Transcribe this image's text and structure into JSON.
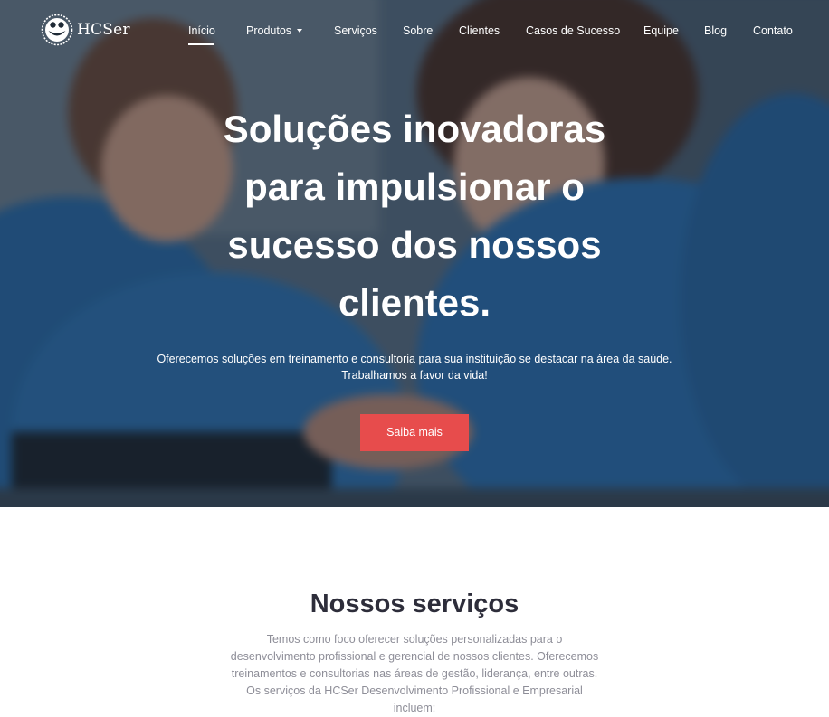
{
  "brand": {
    "name": "HCSer"
  },
  "nav": {
    "items": [
      {
        "label": "Início",
        "active": true
      },
      {
        "label": "Produtos",
        "has_dropdown": true
      },
      {
        "label": "Serviços"
      },
      {
        "label": "Sobre"
      },
      {
        "label": "Clientes"
      },
      {
        "label": "Casos de Sucesso"
      },
      {
        "label": "Equipe"
      },
      {
        "label": "Blog"
      },
      {
        "label": "Contato"
      }
    ]
  },
  "hero": {
    "title": "Soluções inovadoras para impulsionar o sucesso dos nossos clientes.",
    "subtitle_line1": "Oferecemos soluções em treinamento e consultoria para sua instituição se destacar na área da saúde.",
    "subtitle_line2": "Trabalhamos a favor da vida!",
    "cta_label": "Saiba mais"
  },
  "services": {
    "title": "Nossos serviços",
    "description": "Temos como foco oferecer soluções personalizadas para o desenvolvimento profissional e gerencial de nossos clientes. Oferecemos treinamentos e consultorias nas áreas de gestão, liderança, entre outras. Os serviços da HCSer Desenvolvimento Profissional e Empresarial incluem:"
  },
  "colors": {
    "accent": "#e74c4c",
    "heading": "#2d2d3a",
    "muted_text": "#8e8e98",
    "scrubs_blue": "#2e73b0"
  }
}
